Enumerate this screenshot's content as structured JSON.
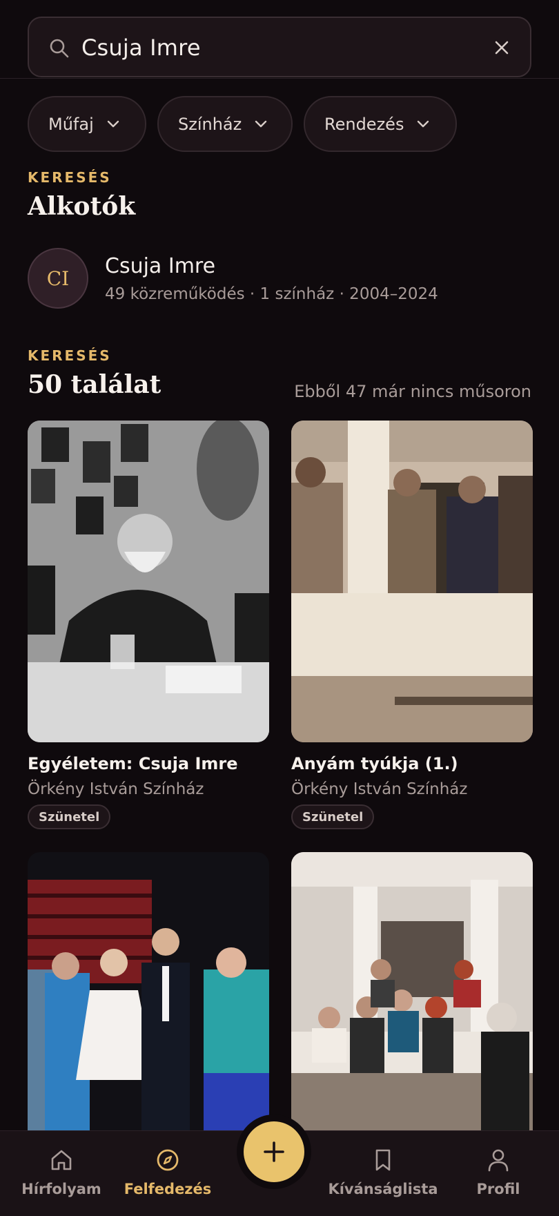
{
  "search": {
    "query": "Csuja Imre"
  },
  "filters": [
    {
      "label": "Műfaj"
    },
    {
      "label": "Színház"
    },
    {
      "label": "Rendezés"
    }
  ],
  "creators_section": {
    "eyebrow": "KERESÉS",
    "title": "Alkotók"
  },
  "creator": {
    "initials": "CI",
    "name": "Csuja Imre",
    "meta": "49 közreműködés · 1 színház · 2004–2024"
  },
  "results_section": {
    "eyebrow": "KERESÉS",
    "title": "50 találat",
    "note": "Ebből 47 már nincs műsoron"
  },
  "results": [
    {
      "title": "Egyéletem: Csuja Imre",
      "theatre": "Örkény István Színház",
      "status": "Szünetel"
    },
    {
      "title": "Anyám tyúkja (1.)",
      "theatre": "Örkény István Színház",
      "status": "Szünetel"
    },
    {
      "title": "",
      "theatre": "",
      "status": ""
    },
    {
      "title": "",
      "theatre": "",
      "status": ""
    }
  ],
  "nav": [
    {
      "label": "Hírfolyam",
      "icon": "home-icon"
    },
    {
      "label": "Felfedezés",
      "icon": "compass-icon",
      "active": true
    },
    {
      "label": "Kívánságlista",
      "icon": "bookmark-icon"
    },
    {
      "label": "Profil",
      "icon": "user-icon"
    }
  ],
  "colors": {
    "accent": "#e5b96a",
    "background": "#0f0a0d",
    "surface": "#1d1418"
  }
}
